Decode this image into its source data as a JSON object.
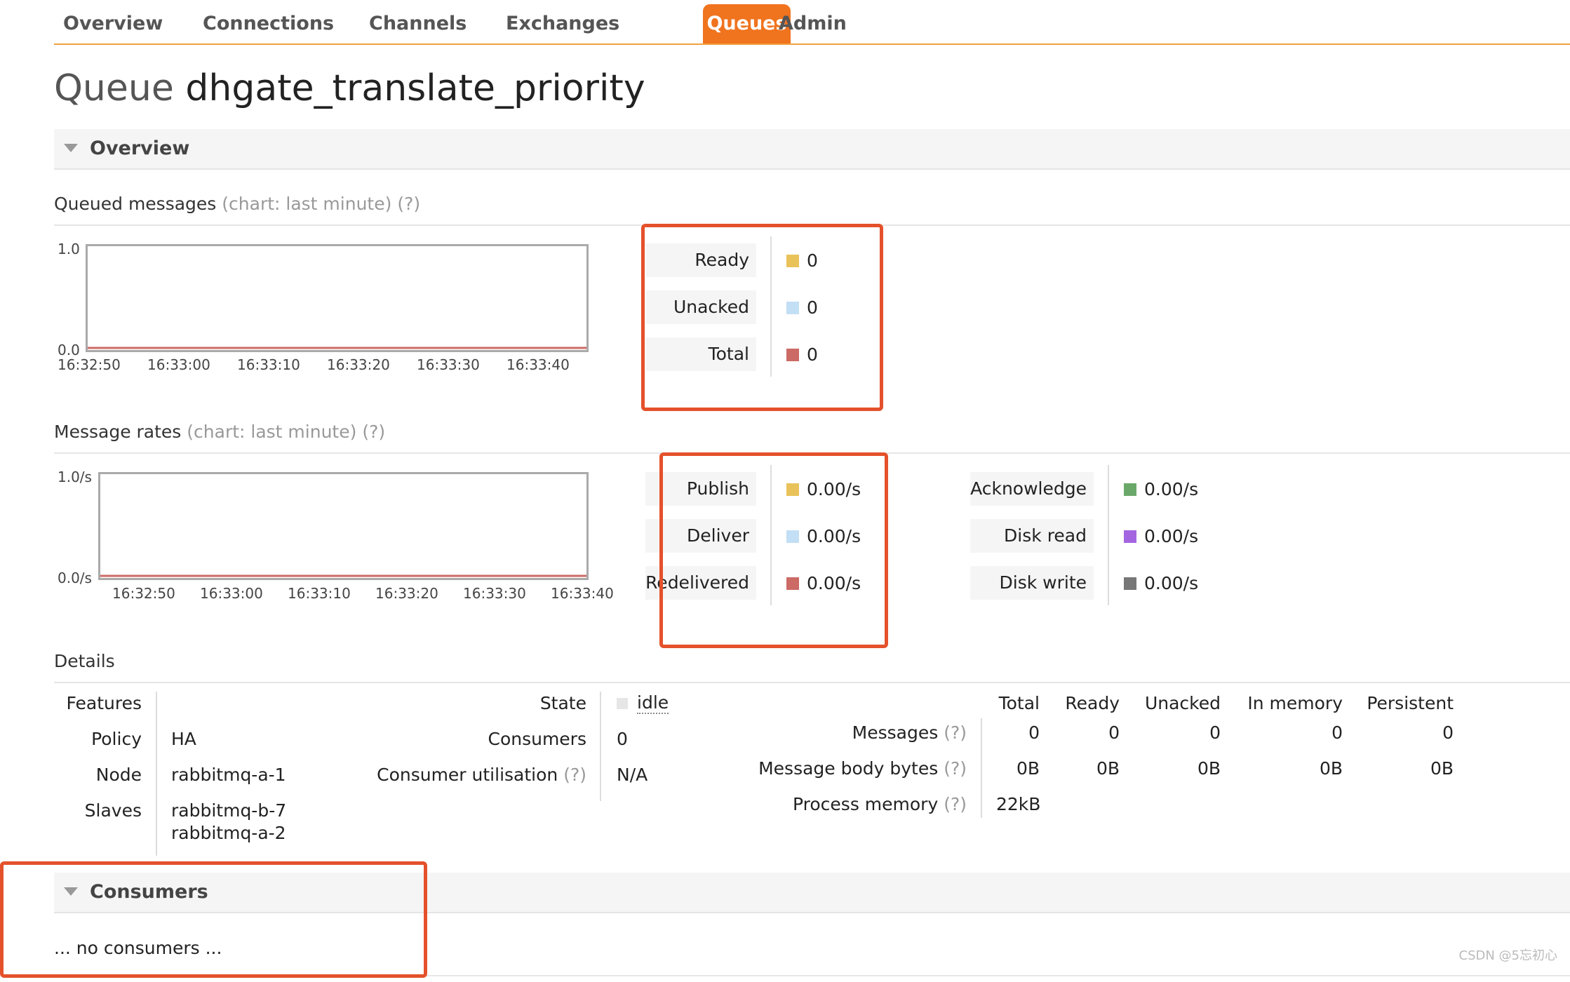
{
  "nav": {
    "items": [
      "Overview",
      "Connections",
      "Channels",
      "Exchanges",
      "Queues",
      "Admin"
    ],
    "active": "Queues"
  },
  "title": {
    "label": "Queue",
    "name": "dhgate_translate_priority"
  },
  "overview_section": {
    "label": "Overview"
  },
  "queued": {
    "header": "Queued messages",
    "chart_note": "(chart: last minute)",
    "help": "(?)",
    "legend": [
      {
        "label": "Ready",
        "value": "0",
        "color": "#e9c35a"
      },
      {
        "label": "Unacked",
        "value": "0",
        "color": "#c3dff5"
      },
      {
        "label": "Total",
        "value": "0",
        "color": "#cc6a65"
      }
    ]
  },
  "rates": {
    "header": "Message rates",
    "chart_note": "(chart: last minute)",
    "help": "(?)",
    "legend_left": [
      {
        "label": "Publish",
        "value": "0.00/s",
        "color": "#e9c35a"
      },
      {
        "label": "Deliver",
        "value": "0.00/s",
        "color": "#c3dff5"
      },
      {
        "label": "Redelivered",
        "value": "0.00/s",
        "color": "#cc6a65"
      }
    ],
    "legend_right": [
      {
        "label": "Acknowledge",
        "value": "0.00/s",
        "color": "#6aa86a"
      },
      {
        "label": "Disk read",
        "value": "0.00/s",
        "color": "#a366e0"
      },
      {
        "label": "Disk write",
        "value": "0.00/s",
        "color": "#777777"
      }
    ]
  },
  "chart_data": [
    {
      "type": "line",
      "ytick_labels": [
        "1.0",
        "0.0"
      ],
      "ylim": [
        0,
        1
      ],
      "x": [
        "16:32:50",
        "16:33:00",
        "16:33:10",
        "16:33:20",
        "16:33:30",
        "16:33:40"
      ],
      "series": [
        {
          "name": "Ready",
          "values": [
            0,
            0,
            0,
            0,
            0,
            0
          ]
        },
        {
          "name": "Unacked",
          "values": [
            0,
            0,
            0,
            0,
            0,
            0
          ]
        },
        {
          "name": "Total",
          "values": [
            0,
            0,
            0,
            0,
            0,
            0
          ]
        }
      ]
    },
    {
      "type": "line",
      "ytick_labels": [
        "1.0/s",
        "0.0/s"
      ],
      "ylim": [
        0,
        1
      ],
      "x": [
        "16:32:50",
        "16:33:00",
        "16:33:10",
        "16:33:20",
        "16:33:30",
        "16:33:40"
      ],
      "series": [
        {
          "name": "Publish",
          "values": [
            0,
            0,
            0,
            0,
            0,
            0
          ]
        },
        {
          "name": "Deliver",
          "values": [
            0,
            0,
            0,
            0,
            0,
            0
          ]
        },
        {
          "name": "Redelivered",
          "values": [
            0,
            0,
            0,
            0,
            0,
            0
          ]
        }
      ]
    }
  ],
  "details": {
    "header": "Details",
    "features_label": "Features",
    "policy_label": "Policy",
    "policy_value": "HA",
    "node_label": "Node",
    "node_value": "rabbitmq-a-1",
    "slaves_label": "Slaves",
    "slaves": [
      "rabbitmq-b-7",
      "rabbitmq-a-2"
    ],
    "state_label": "State",
    "state_value": "idle",
    "consumers_label": "Consumers",
    "consumers_value": "0",
    "util_label": "Consumer utilisation",
    "util_help": "(?)",
    "util_value": "N/A",
    "stats_headers": [
      "Total",
      "Ready",
      "Unacked",
      "In memory",
      "Persistent"
    ],
    "messages_label": "Messages",
    "messages_help": "(?)",
    "messages_values": [
      "0",
      "0",
      "0",
      "0",
      "0"
    ],
    "body_label": "Message body bytes",
    "body_help": "(?)",
    "body_values": [
      "0B",
      "0B",
      "0B",
      "0B",
      "0B"
    ],
    "proc_label": "Process memory",
    "proc_help": "(?)",
    "proc_value": "22kB"
  },
  "consumers_section": {
    "label": "Consumers",
    "empty": "... no consumers ..."
  },
  "watermark": "CSDN @5忘初心"
}
